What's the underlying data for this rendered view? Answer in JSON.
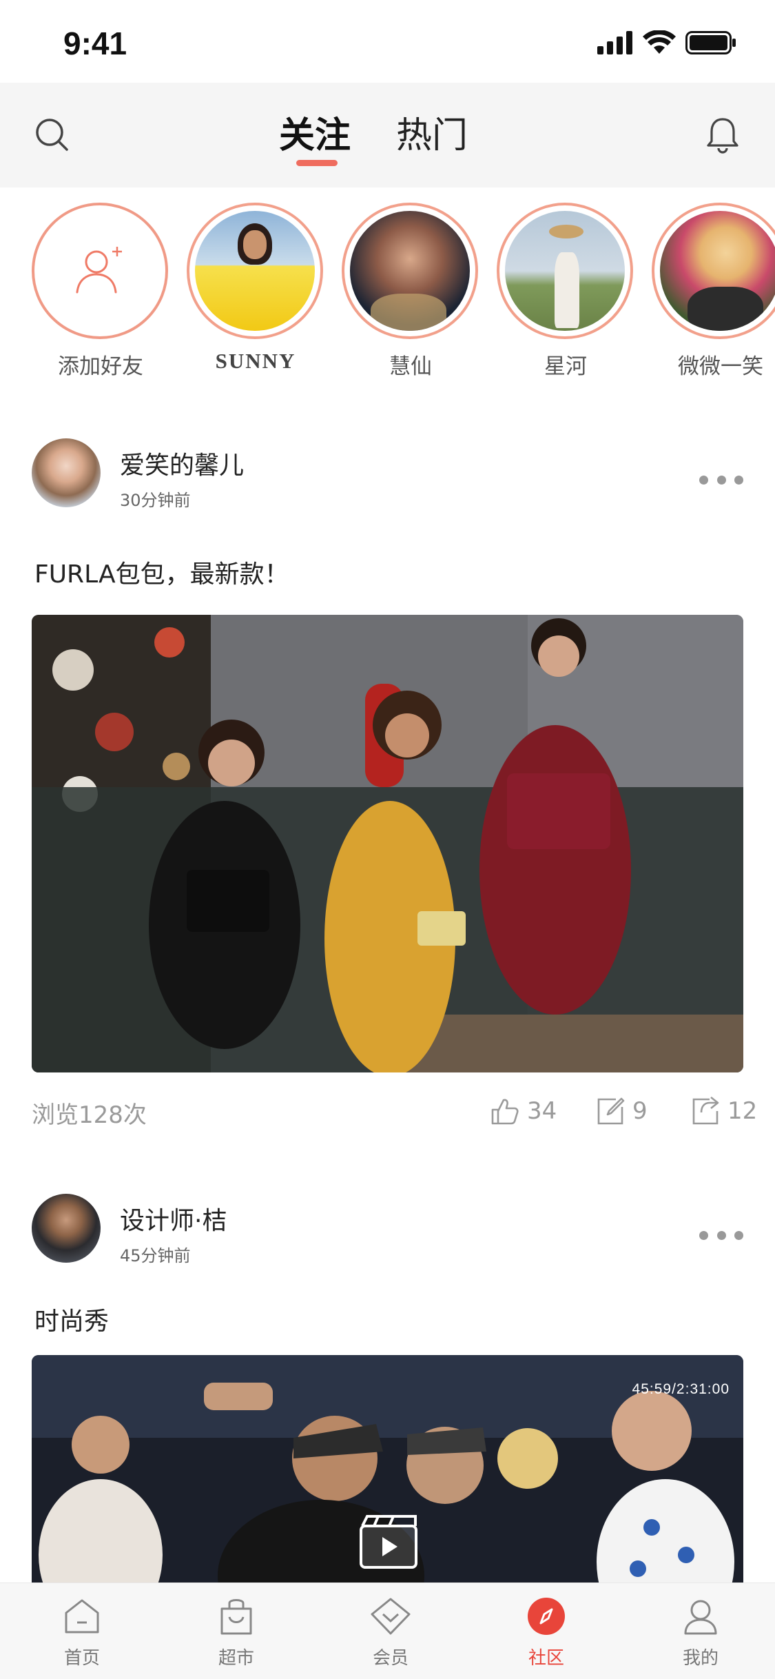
{
  "status_bar": {
    "time": "9:41"
  },
  "header": {
    "tabs": [
      {
        "label": "关注",
        "active": true
      },
      {
        "label": "热门",
        "active": false
      }
    ]
  },
  "stories": [
    {
      "label": "添加好友",
      "type": "add"
    },
    {
      "label": "SUNNY"
    },
    {
      "label": "慧仙"
    },
    {
      "label": "星河"
    },
    {
      "label": "微微一笑"
    }
  ],
  "posts": [
    {
      "username": "爱笑的馨儿",
      "time": "30分钟前",
      "text": "FURLA包包，最新款！",
      "views": "浏览128次",
      "likes": "34",
      "comments": "9",
      "shares": "12"
    },
    {
      "username": "设计师·桔",
      "time": "45分钟前",
      "text": "时尚秀",
      "duration": "45:59/2:31:00"
    }
  ],
  "tabbar": {
    "items": [
      {
        "label": "首页",
        "icon": "home-icon",
        "active": false
      },
      {
        "label": "超市",
        "icon": "shopping-bag-icon",
        "active": false
      },
      {
        "label": "会员",
        "icon": "member-diamond-icon",
        "active": false
      },
      {
        "label": "社区",
        "icon": "compass-icon",
        "active": true
      },
      {
        "label": "我的",
        "icon": "person-icon",
        "active": false
      }
    ]
  },
  "colors": {
    "accent": "#ef6c5e",
    "ring": "#f2a08b",
    "active_nav": "#e8453a"
  }
}
